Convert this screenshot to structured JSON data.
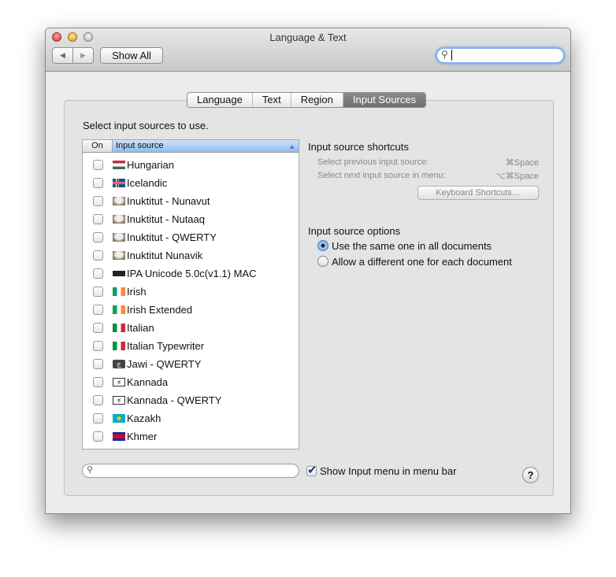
{
  "window": {
    "title": "Language & Text"
  },
  "toolbar": {
    "show_all": "Show All",
    "search_value": ""
  },
  "tabs": [
    {
      "label": "Language",
      "selected": false
    },
    {
      "label": "Text",
      "selected": false
    },
    {
      "label": "Region",
      "selected": false
    },
    {
      "label": "Input Sources",
      "selected": true
    }
  ],
  "main": {
    "instruction": "Select input sources to use.",
    "col_on": "On",
    "col_source": "Input source",
    "sources": [
      {
        "name": "Hungarian",
        "icon": "flag-hungary",
        "on": false
      },
      {
        "name": "Icelandic",
        "icon": "flag-iceland",
        "on": false
      },
      {
        "name": "Inuktitut - Nunavut",
        "icon": "inuktitut-icon",
        "on": false
      },
      {
        "name": "Inuktitut - Nutaaq",
        "icon": "inuktitut-icon",
        "on": false
      },
      {
        "name": "Inuktitut - QWERTY",
        "icon": "inuktitut-icon",
        "on": false
      },
      {
        "name": "Inuktitut Nunavik",
        "icon": "inuktitut-icon",
        "on": false
      },
      {
        "name": "IPA Unicode 5.0c(v1.1) MAC",
        "icon": "keyboard-icon",
        "on": false
      },
      {
        "name": "Irish",
        "icon": "flag-ireland",
        "on": false
      },
      {
        "name": "Irish Extended",
        "icon": "flag-ireland",
        "on": false
      },
      {
        "name": "Italian",
        "icon": "flag-italy",
        "on": false
      },
      {
        "name": "Italian Typewriter",
        "icon": "flag-italy",
        "on": false
      },
      {
        "name": "Jawi - QWERTY",
        "icon": "jawi-icon",
        "on": false
      },
      {
        "name": "Kannada",
        "icon": "kannada-icon",
        "on": false
      },
      {
        "name": "Kannada - QWERTY",
        "icon": "kannada-icon",
        "on": false
      },
      {
        "name": "Kazakh",
        "icon": "flag-kazakhstan",
        "on": false
      },
      {
        "name": "Khmer",
        "icon": "flag-cambodia",
        "on": false
      }
    ]
  },
  "shortcuts": {
    "title": "Input source shortcuts",
    "prev_label": "Select previous input source:",
    "prev_keys": "⌘Space",
    "next_label": "Select next input source in menu:",
    "next_keys": "⌥⌘Space",
    "button": "Keyboard Shortcuts…"
  },
  "options": {
    "title": "Input source options",
    "opt1": "Use the same one in all documents",
    "opt2": "Allow a different one for each document",
    "selected": 1
  },
  "bottom": {
    "search_value": "",
    "show_menu_label": "Show Input menu in menu bar",
    "show_menu_checked": true,
    "help": "?"
  }
}
